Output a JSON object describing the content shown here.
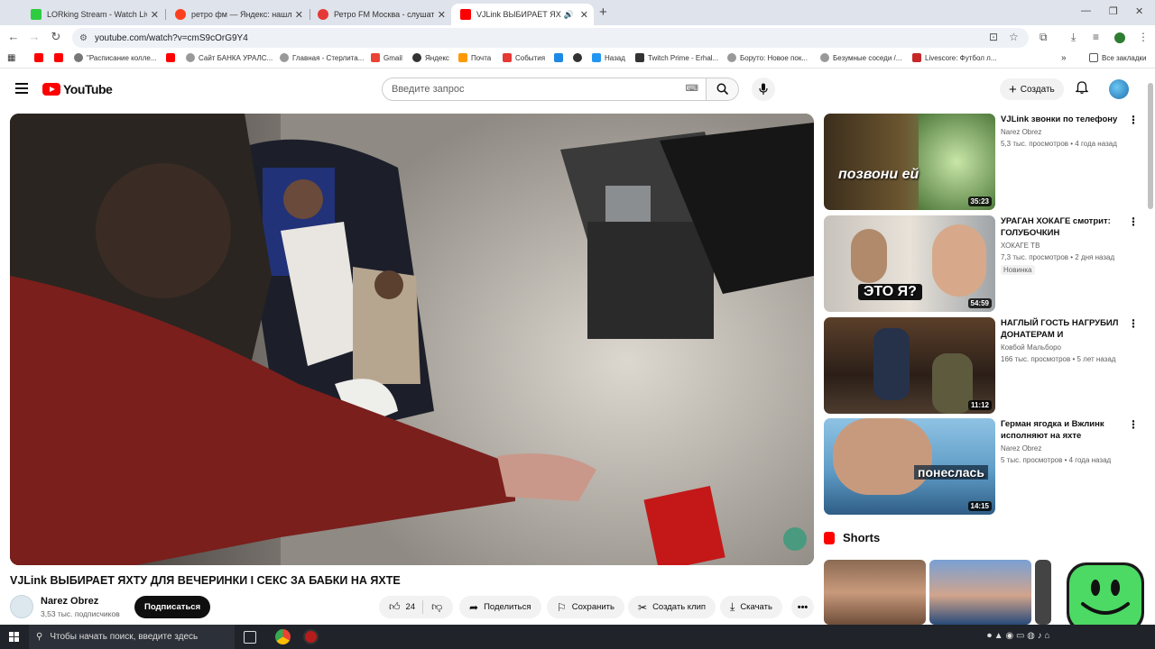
{
  "browser": {
    "tabs": [
      {
        "title": "LORking Stream - Watch Live o",
        "favicon_color": "#2ecc40"
      },
      {
        "title": "ретро фм — Яндекс: нашлось",
        "favicon_color": "#fc3f1d"
      },
      {
        "title": "Ретро FM Москва - слушать о",
        "favicon_color": "#e53935"
      },
      {
        "title": "VJLink ВЫБИРАЕТ ЯХТУ ДЛ",
        "favicon_color": "#ff0000"
      }
    ],
    "url": "youtube.com/watch?v=cmS9cOrG9Y4",
    "bookmarks": [
      {
        "label": "",
        "color": "#ff0000"
      },
      {
        "label": "",
        "color": "#ff0000"
      },
      {
        "label": "\"Расписание колле...",
        "color": "#777777"
      },
      {
        "label": "",
        "color": "#ff0000"
      },
      {
        "label": "Сайт БАНКА УРАЛС...",
        "color": "#999999"
      },
      {
        "label": "Главная - Стерлита...",
        "color": "#999999"
      },
      {
        "label": "Gmail",
        "color": "#ea4335"
      },
      {
        "label": "Яндекс",
        "color": "#333333"
      },
      {
        "label": "Почта",
        "color": "#ff9900"
      },
      {
        "label": "События",
        "color": "#e53935"
      },
      {
        "label": "",
        "color": "#1e88e5"
      },
      {
        "label": "",
        "color": "#333333"
      },
      {
        "label": "Назад",
        "color": "#2196f3"
      },
      {
        "label": "Twitch Prime - Erhal...",
        "color": "#333333"
      },
      {
        "label": "Боруто: Новое пок...",
        "color": "#999999"
      },
      {
        "label": "Безумные соседи /...",
        "color": "#999999"
      },
      {
        "label": "Livescore: Футбол л...",
        "color": "#c62828"
      }
    ],
    "all_bookmarks": "Все закладки"
  },
  "youtube": {
    "logo_text": "YouTube",
    "search_placeholder": "Введите запрос",
    "create_label": "Создать"
  },
  "video": {
    "title": "VJLink ВЫБИРАЕТ ЯХТУ ДЛЯ ВЕЧЕРИНКИ I СЕКС ЗА БАБКИ НА ЯХТЕ",
    "channel": "Narez Obrez",
    "subscribers": "3,53 тыс. подписчиков",
    "subscribe_label": "Подписаться",
    "likes": "24",
    "share_label": "Поделиться",
    "save_label": "Сохранить",
    "clip_label": "Создать клип",
    "download_label": "Скачать"
  },
  "recommendations": [
    {
      "title": "VJLink звонки по телефону",
      "channel": "Narez Obrez",
      "meta": "5,3 тыс. просмотров • 4 года назад",
      "duration": "35:23",
      "thumb_text": "позвони ей",
      "badge": ""
    },
    {
      "title": "УРАГАН ХОКАГЕ смотрит: ГОЛУБОЧКИН УНИЧТОЖАЕТ...",
      "channel": "ХОКАГЕ ТВ",
      "meta": "7,3 тыс. просмотров • 2 дня назад",
      "duration": "54:59",
      "thumb_text": "ЭТО Я?",
      "badge": "Новинка"
    },
    {
      "title": "НАГЛЫЙ ГОСТЬ НАГРУБИЛ ДОНАТЕРАМ И ПОПЛАТИЛС...",
      "channel": "Ковбой Мальборо",
      "meta": "166 тыс. просмотров • 5 лет назад",
      "duration": "11:12",
      "thumb_text": "",
      "badge": ""
    },
    {
      "title": "Герман ягодка и Вжлинк исполняют на яхте",
      "channel": "Narez Obrez",
      "meta": "5 тыс. просмотров • 4 года назад",
      "duration": "14:15",
      "thumb_text": "понеслась",
      "badge": ""
    }
  ],
  "shorts": {
    "heading": "Shorts"
  },
  "taskbar": {
    "search_placeholder": "Чтобы начать поиск, введите здесь"
  }
}
